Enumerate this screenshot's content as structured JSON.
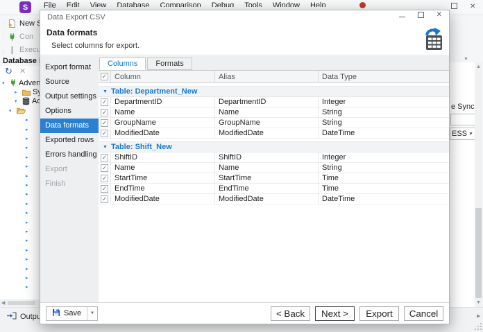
{
  "window": {
    "logo_letter": "S",
    "menu_items": [
      "File",
      "Edit",
      "View",
      "Database",
      "Comparison",
      "Debug",
      "Tools",
      "Window",
      "Help"
    ]
  },
  "background": {
    "toolbar": [
      {
        "icon": "new-sql-icon",
        "label": "New S",
        "state": "normal"
      },
      {
        "icon": "connect-icon",
        "label": "Con",
        "state": "dimmed"
      },
      {
        "icon": "execute-icon",
        "label": "Execut",
        "state": "dimmed"
      }
    ],
    "explorer_title": "Database Ex",
    "tree": {
      "items": [
        {
          "expander": "down",
          "icon": "connection-icon",
          "label": "Advent",
          "indent": 0
        },
        {
          "expander": "right",
          "icon": "folder-icon",
          "label": "Sys",
          "indent": 1
        },
        {
          "expander": "down",
          "icon": "database-icon",
          "label": "Ad",
          "indent": 1
        },
        {
          "expander": "down",
          "icon": "open-folder-icon",
          "label": "",
          "indent": 2
        }
      ],
      "collapsed_placeholder_count": 19
    },
    "output_tab_label": "Output",
    "right_fragments": {
      "doc_label": "e Sync",
      "combo_value": "ESS"
    }
  },
  "dialog": {
    "title": "Data Export CSV",
    "header": {
      "title": "Data formats",
      "subtitle": "Select columns for export."
    },
    "steps": [
      {
        "label": "Export format",
        "state": "enabled"
      },
      {
        "label": "Source",
        "state": "enabled"
      },
      {
        "label": "Output settings",
        "state": "enabled"
      },
      {
        "label": "Options",
        "state": "enabled"
      },
      {
        "label": "Data formats",
        "state": "selected"
      },
      {
        "label": "Exported rows",
        "state": "enabled"
      },
      {
        "label": "Errors handling",
        "state": "enabled"
      },
      {
        "label": "Export",
        "state": "disabled"
      },
      {
        "label": "Finish",
        "state": "disabled"
      }
    ],
    "tabs": [
      {
        "label": "Columns",
        "active": true
      },
      {
        "label": "Formats",
        "active": false
      }
    ],
    "grid": {
      "columns": [
        "Column",
        "Alias",
        "Data Type"
      ],
      "groups": [
        {
          "label": "Table: Department_New",
          "rows": [
            {
              "checked": true,
              "column": "DepartmentID",
              "alias": "DepartmentID",
              "type": "Integer"
            },
            {
              "checked": true,
              "column": "Name",
              "alias": "Name",
              "type": "String"
            },
            {
              "checked": true,
              "column": "GroupName",
              "alias": "GroupName",
              "type": "String"
            },
            {
              "checked": true,
              "column": "ModifiedDate",
              "alias": "ModifiedDate",
              "type": "DateTime"
            }
          ]
        },
        {
          "label": "Table: Shift_New",
          "rows": [
            {
              "checked": true,
              "column": "ShiftID",
              "alias": "ShiftID",
              "type": "Integer"
            },
            {
              "checked": true,
              "column": "Name",
              "alias": "Name",
              "type": "String"
            },
            {
              "checked": true,
              "column": "StartTime",
              "alias": "StartTime",
              "type": "Time"
            },
            {
              "checked": true,
              "column": "EndTime",
              "alias": "EndTime",
              "type": "Time"
            },
            {
              "checked": true,
              "column": "ModifiedDate",
              "alias": "ModifiedDate",
              "type": "DateTime"
            }
          ]
        }
      ]
    },
    "buttons": {
      "save": "Save",
      "back": "< Back",
      "next": "Next >",
      "export": "Export",
      "cancel": "Cancel"
    }
  },
  "colors": {
    "accent_blue": "#1779d2",
    "selected_step_bg": "#2c80d0",
    "logo_purple": "#7b2fbe",
    "notification_red": "#c23b2e"
  }
}
